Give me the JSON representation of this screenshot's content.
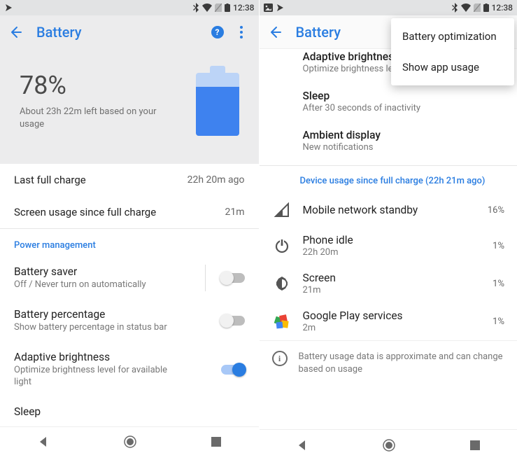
{
  "status": {
    "time": "12:38"
  },
  "left": {
    "title": "Battery",
    "percent": "78%",
    "estimate": "About 23h 22m left based on your usage",
    "last_charge_label": "Last full charge",
    "last_charge_value": "22h 20m ago",
    "screen_usage_label": "Screen usage since full charge",
    "screen_usage_value": "21m",
    "section_pm": "Power management",
    "settings": {
      "saver": {
        "title": "Battery saver",
        "sub": "Off / Never turn on automatically",
        "on": false
      },
      "percentage": {
        "title": "Battery percentage",
        "sub": "Show battery percentage in status bar",
        "on": false
      },
      "adaptive": {
        "title": "Adaptive brightness",
        "sub": "Optimize brightness level for available light",
        "on": true
      },
      "sleep": {
        "title": "Sleep"
      }
    }
  },
  "right": {
    "title": "Battery",
    "menu": {
      "opt": "Battery optimization",
      "usage": "Show app usage"
    },
    "adaptive": {
      "title": "Adaptive brightness",
      "sub": "Optimize brightness level for available light"
    },
    "sleep": {
      "title": "Sleep",
      "sub": "After 30 seconds of inactivity"
    },
    "ambient": {
      "title": "Ambient display",
      "sub": "New notifications"
    },
    "section": "Device usage since full charge (22h 21m ago)",
    "usage": [
      {
        "name": "Mobile network standby",
        "sub": "",
        "pct": "16%",
        "icon": "signal"
      },
      {
        "name": "Phone idle",
        "sub": "22h 20m",
        "pct": "1%",
        "icon": "power"
      },
      {
        "name": "Screen",
        "sub": "21m",
        "pct": "1%",
        "icon": "brightness"
      },
      {
        "name": "Google Play services",
        "sub": "2m",
        "pct": "1%",
        "icon": "play"
      }
    ],
    "info": "Battery usage data is approximate and can change based on usage"
  }
}
